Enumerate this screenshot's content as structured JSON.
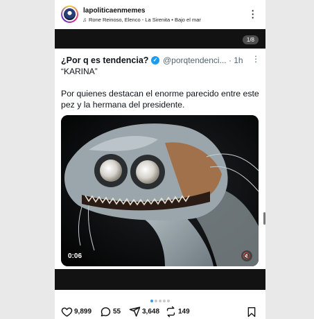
{
  "post": {
    "username": "lapoliticaenmemes",
    "music": "Rone Reinoso, Elenco - La Sirenita • Bajo el mar",
    "carousel_counter": "1/8"
  },
  "tweet": {
    "name": "¿Por q es tendencia?",
    "verified_glyph": "✓",
    "handle": "@porqtendenci...",
    "time": "· 1h",
    "quote": "“KARINA”",
    "body": "Por quienes destacan el enorme parecido entre este pez y la hermana del presidente.",
    "video_duration": "0:06"
  },
  "actions": {
    "likes": "9,899",
    "comments": "55",
    "shares": "3,648",
    "reposts": "149"
  },
  "icons": {
    "more": "more-vertical-icon",
    "music": "music-note-icon",
    "like": "heart-icon",
    "comment": "comment-icon",
    "share": "send-icon",
    "repost": "repost-icon",
    "save": "bookmark-icon",
    "mute": "mute-icon"
  },
  "colors": {
    "verified": "#1d9bf0",
    "active_dot": "#3897f0"
  }
}
